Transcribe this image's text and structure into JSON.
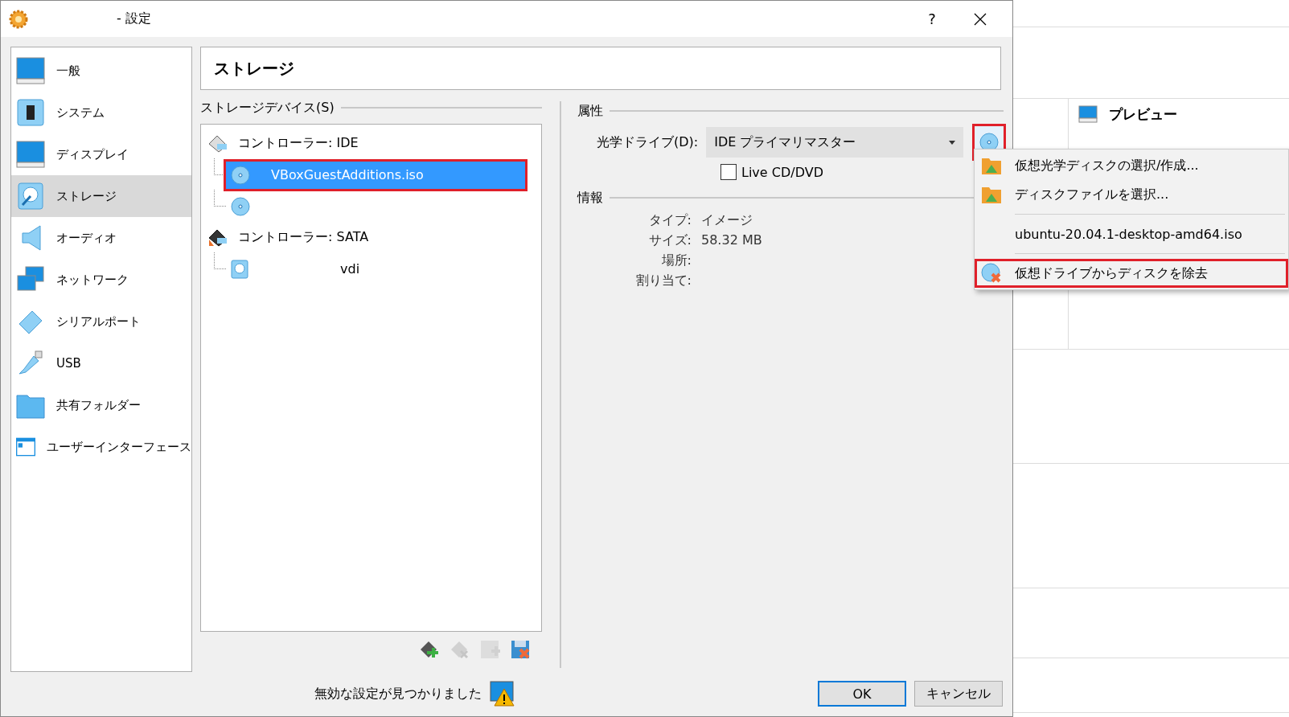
{
  "window": {
    "title": "- 設定",
    "help": "?"
  },
  "sidebar": {
    "items": [
      {
        "label": "一般",
        "selected": false
      },
      {
        "label": "システム",
        "selected": false
      },
      {
        "label": "ディスプレイ",
        "selected": false
      },
      {
        "label": "ストレージ",
        "selected": true
      },
      {
        "label": "オーディオ",
        "selected": false
      },
      {
        "label": "ネットワーク",
        "selected": false
      },
      {
        "label": "シリアルポート",
        "selected": false
      },
      {
        "label": "USB",
        "selected": false
      },
      {
        "label": "共有フォルダー",
        "selected": false
      },
      {
        "label": "ユーザーインターフェース",
        "selected": false
      }
    ]
  },
  "page_title": "ストレージ",
  "storage_devices": {
    "title": "ストレージデバイス(S)",
    "tree": [
      {
        "kind": "controller",
        "label": "コントローラー: IDE",
        "children": [
          {
            "kind": "optical",
            "label": "VBoxGuestAdditions.iso",
            "selected": true,
            "annotated": true
          },
          {
            "kind": "optical",
            "selected": false,
            "annotated": false
          }
        ]
      },
      {
        "kind": "controller-sata",
        "label": "コントローラー: SATA",
        "children": [
          {
            "kind": "disk",
            "label": "vdi",
            "selected": false,
            "annotated": false
          }
        ]
      }
    ],
    "tool_buttons": [
      {
        "kind": "add-controller",
        "disabled": false
      },
      {
        "kind": "remove-controller",
        "disabled": true
      },
      {
        "kind": "add-attachment",
        "disabled": true
      },
      {
        "kind": "remove-attachment",
        "disabled": false
      }
    ]
  },
  "attributes": {
    "title": "属性",
    "optical_drive": {
      "label": "光学ドライブ(D):",
      "value": "IDE プライマリマスター",
      "annotated": true
    },
    "live_cd": {
      "label": "Live CD/DVD",
      "checked": false
    }
  },
  "info": {
    "title": "情報",
    "rows": [
      {
        "label": "タイプ:",
        "value": "イメージ"
      },
      {
        "label": "サイズ:",
        "value": "58.32 MB"
      },
      {
        "label": "場所:"
      },
      {
        "label": "割り当て:"
      }
    ]
  },
  "menu": {
    "items": [
      {
        "kind": "folder-item",
        "label": "仮想光学ディスクの選択/作成...",
        "annotated": false
      },
      {
        "kind": "folder-item",
        "label": "ディスクファイルを選択...",
        "annotated": false
      },
      {
        "kind": "separator"
      },
      {
        "kind": "plain-item",
        "label": "ubuntu-20.04.1-desktop-amd64.iso",
        "annotated": false
      },
      {
        "kind": "separator"
      },
      {
        "kind": "remove-item",
        "label": "仮想ドライブからディスクを除去",
        "annotated": true
      }
    ]
  },
  "status": {
    "warning": "無効な設定が見つかりました"
  },
  "buttons": [
    {
      "label": "OK",
      "default": true
    },
    {
      "label": "キャンセル",
      "default": false
    }
  ],
  "background_window": {
    "preview_title": "プレビュー"
  }
}
